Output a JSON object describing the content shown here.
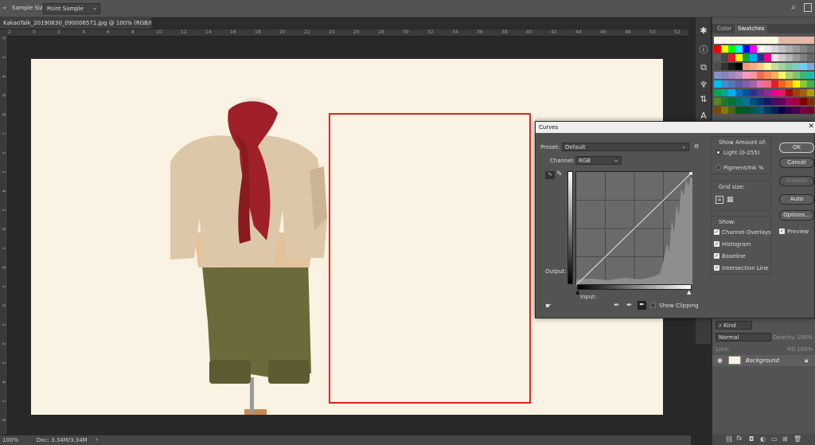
{
  "options_bar": {
    "sample_size_label": "Sample Size:",
    "sample_size_value": "Point Sample"
  },
  "document": {
    "tab_title": "KakaoTalk_20190830_090006571.jpg @ 100% (RGB/8#) *",
    "close_symbol": "×"
  },
  "ruler": {
    "h_ticks": [
      "2",
      "0",
      "2",
      "4",
      "6",
      "8",
      "10",
      "12",
      "14",
      "16",
      "18",
      "20",
      "22",
      "24",
      "26",
      "28",
      "30",
      "32",
      "34",
      "36",
      "38",
      "40",
      "42",
      "44",
      "46",
      "48",
      "50",
      "52"
    ],
    "v_ticks": [
      "0",
      "2",
      "4",
      "6",
      "8",
      "1",
      "2",
      "1",
      "4",
      "1",
      "6",
      "1",
      "8",
      "2",
      "0",
      "2",
      "2",
      "2",
      "4",
      "2",
      "6"
    ]
  },
  "status": {
    "zoom": "100%",
    "doc_info": "Doc: 3.34M/3.34M",
    "arrow": "›"
  },
  "panels": {
    "color_tab": "Color",
    "swatches_tab": "Swatches"
  },
  "swatches": {
    "rows": [
      [
        "#fff7e3",
        "#fff7e3",
        "#fff7e3",
        "#fff7e3",
        "#fff7e3",
        "#fff7e3",
        "#fff7e3",
        "#fff7e3",
        "#fff7e3",
        "#e8b8a6",
        "#e8b8a6",
        "#e8b8a6",
        "#e8b8a6",
        "#e8b8a6"
      ],
      [
        "#ff0000",
        "#ffff00",
        "#00ff00",
        "#00ffff",
        "#0000ff",
        "#ff00ff",
        "#ffffff",
        "#ebebeb",
        "#d6d6d6",
        "#c2c2c2",
        "#adadad",
        "#999999",
        "#858585",
        "#707070"
      ],
      [
        "#5c5c5c",
        "#474747",
        "#ed1c24",
        "#fff200",
        "#00a651",
        "#00aeef",
        "#2e3192",
        "#ec008c",
        "#e6e6e6",
        "#cccccc",
        "#b3b3b3",
        "#999999",
        "#808080",
        "#666666"
      ],
      [
        "#4d4d4d",
        "#333333",
        "#1a1a1a",
        "#000000",
        "#f7977a",
        "#f9ad81",
        "#fdc68a",
        "#fff79a",
        "#c4df9b",
        "#a2d39c",
        "#82ca9d",
        "#7bcdc8",
        "#6ecff6",
        "#7ea7d8"
      ],
      [
        "#8493ca",
        "#8882be",
        "#a187be",
        "#bc8dbf",
        "#f49ac2",
        "#f6989d",
        "#f26c4f",
        "#f68e55",
        "#fbaf5c",
        "#fff467",
        "#acd372",
        "#7cc576",
        "#3bb878",
        "#1abbb4"
      ],
      [
        "#00bff3",
        "#438ccb",
        "#5574b9",
        "#605ca8",
        "#855fa8",
        "#a763a8",
        "#f06ea9",
        "#f26d7d",
        "#ed1c24",
        "#f26522",
        "#f7941d",
        "#fff200",
        "#8dc73f",
        "#39b54a"
      ],
      [
        "#00a651",
        "#00a99d",
        "#00aeef",
        "#0072bc",
        "#0054a6",
        "#2e3192",
        "#662d91",
        "#92278f",
        "#ec008c",
        "#ed145b",
        "#9e0b0f",
        "#a0410d",
        "#a3620a",
        "#aba000"
      ],
      [
        "#598527",
        "#197b30",
        "#007236",
        "#00746b",
        "#0076a3",
        "#004b80",
        "#003471",
        "#1b1464",
        "#440e62",
        "#630460",
        "#9e005d",
        "#9e0039",
        "#790000",
        "#7b2e00"
      ],
      [
        "#7d4900",
        "#827b00",
        "#406618",
        "#005e20",
        "#005826",
        "#005952",
        "#005b7f",
        "#003663",
        "#002157",
        "#0d004c",
        "#32004b",
        "#4b0049",
        "#7b0046",
        "#7a0026"
      ]
    ]
  },
  "curves_dialog": {
    "title": "Curves",
    "preset_label": "Preset:",
    "preset_value": "Default",
    "channel_label": "Channel:",
    "channel_value": "RGB",
    "output_label": "Output:",
    "input_label": "Input:",
    "show_clipping_label": "Show Clipping",
    "show_amount_label": "Show Amount of:",
    "light_label": "Light  (0-255)",
    "pigment_label": "Pigment/Ink %",
    "grid_size_label": "Grid size:",
    "show_label": "Show:",
    "channel_overlays_label": "Channel Overlays",
    "histogram_label": "Histogram",
    "baseline_label": "Baseline",
    "intersection_line_label": "Intersection Line",
    "ok_label": "OK",
    "cancel_label": "Cancel",
    "smooth_label": "Smooth",
    "auto_label": "Auto",
    "options_label": "Options...",
    "preview_label": "Preview",
    "checks": {
      "channel_overlays": true,
      "histogram": true,
      "baseline": true,
      "intersection_line": true,
      "preview": true,
      "show_clipping": false
    },
    "light_selected": true
  },
  "layers": {
    "kind_label": "Kind",
    "blend_mode": "Normal",
    "opacity_label": "Opacity:",
    "opacity_value": "100%",
    "lock_label": "Lock:",
    "fill_label": "Fill:",
    "fill_value": "100%",
    "background_layer": "Background"
  },
  "colors": {
    "selection_border": "#e32222",
    "canvas_bg": "#faf3e3"
  }
}
